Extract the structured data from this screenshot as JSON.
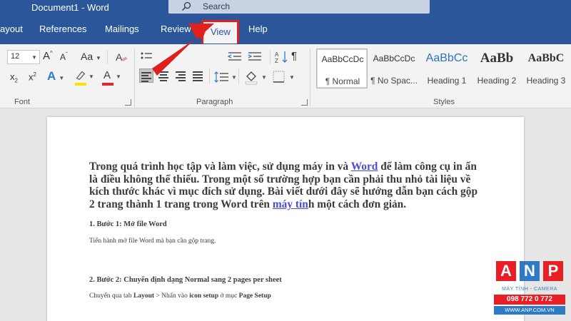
{
  "titlebar": {
    "doc_title": "Document1  -  Word",
    "search_placeholder": "Search"
  },
  "tabs": {
    "layout": "ayout",
    "references": "References",
    "mailings": "Mailings",
    "review": "Review",
    "view": "View",
    "help": "Help"
  },
  "ribbon": {
    "font_size": "12",
    "font_group": "Font",
    "paragraph_group": "Paragraph",
    "styles_group": "Styles",
    "styles": [
      {
        "sample": "AaBbCcDc",
        "name": "¶ Normal"
      },
      {
        "sample": "AaBbCcDc",
        "name": "¶ No Spac..."
      },
      {
        "sample": "AaBbCc",
        "name": "Heading 1"
      },
      {
        "sample": "AaBb",
        "name": "Heading 2"
      },
      {
        "sample": "AaBbC",
        "name": "Heading 3"
      }
    ],
    "glyphs": {
      "grow": "A",
      "grow_sup": "^",
      "shrink": "A",
      "shrink_sup": "ˇ",
      "case": "Aa",
      "subscript": "x",
      "sub2": "2",
      "superscript": "x",
      "sup2": "2",
      "text_effects": "A",
      "font_color": "A",
      "pilcrow": "¶"
    }
  },
  "document": {
    "para1_a": "Trong quá trình học tập và làm việc, sử dụng máy in và ",
    "link1": "Word",
    "para1_b": " để làm công cụ in ấn là điều không thể thiếu. Trong một số trường hợp bạn cần phải thu nhỏ tài liệu về kích thước khác vì mục đích sử dụng. Bài viết dưới đây sẽ hướng dẫn bạn cách gộp 2 trang thành 1 trang trong Word trên ",
    "link2": "máy tín",
    "para1_c": "h một cách đơn giản.",
    "step1_heading": "1. Bước 1: Mở file Word",
    "step1_text": "Tiến hành mở file Word mà bạn cần gộp trang.",
    "step2_heading": "2. Bước 2: Chuyển định dạng Normal sang 2 pages per sheet",
    "step2_text_a": "Chuyển qua tab ",
    "step2_layout": "Layout",
    "step2_text_b": " > Nhấn vào ",
    "step2_icon_setup": "icon setup",
    "step2_text_c": " ở mục ",
    "step2_page_setup": "Page Setup"
  },
  "logo": {
    "letters": [
      "A",
      "N",
      "P"
    ],
    "subtitle": "MÁY TÍNH - CAMERA",
    "phone": "098 772 0 772",
    "website": "WWW.ANP.COM.VN"
  },
  "colors": {
    "word_blue": "#2b579a",
    "arrow_red": "#e01f1f",
    "link_blue": "#4b4bd6"
  }
}
